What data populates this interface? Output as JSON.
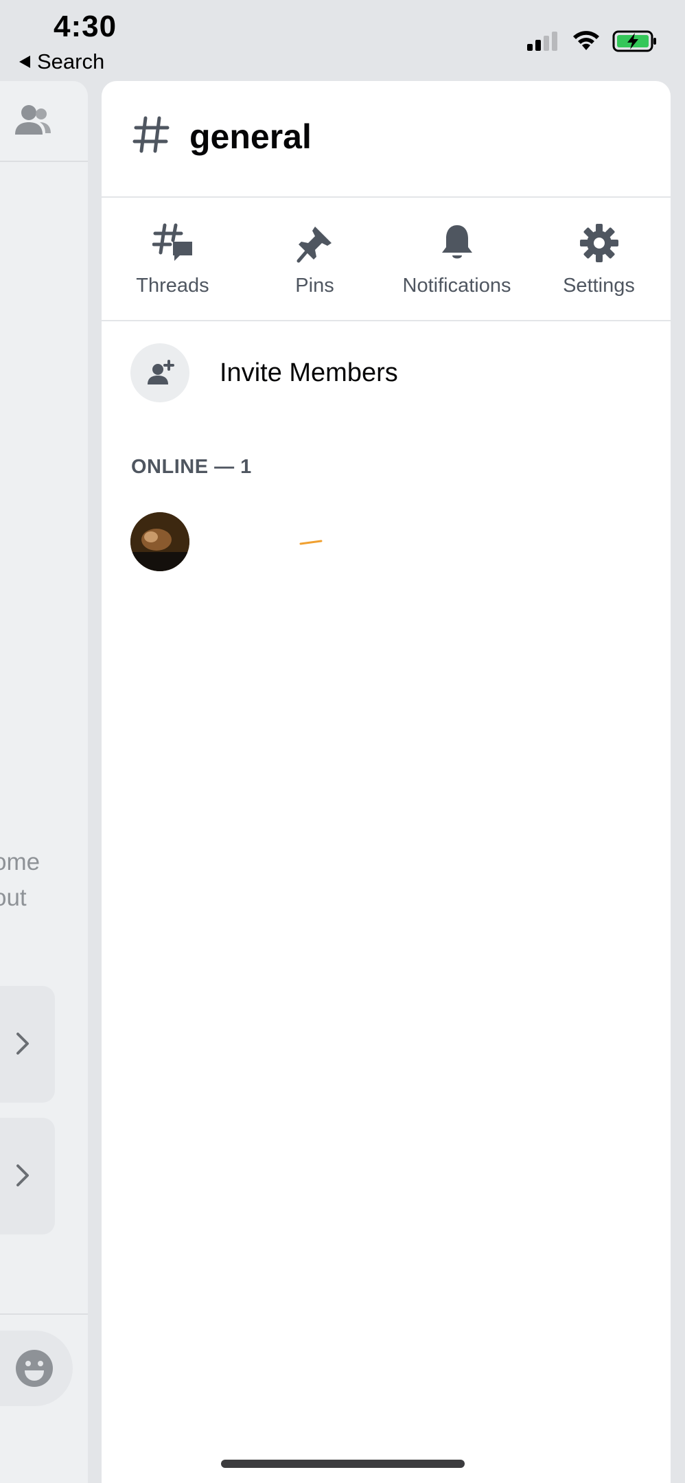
{
  "status_bar": {
    "time": "4:30",
    "back_label": "Search",
    "icons": [
      "cellular-signal-icon",
      "wifi-icon",
      "battery-charging-icon"
    ],
    "battery_color": "#34c759"
  },
  "background_panel": {
    "text_line_1": "ome",
    "text_line_2": "out"
  },
  "channel": {
    "name": "general",
    "icon": "hashtag-icon"
  },
  "actions": [
    {
      "label": "Threads",
      "icon": "threads-icon"
    },
    {
      "label": "Pins",
      "icon": "pin-icon"
    },
    {
      "label": "Notifications",
      "icon": "bell-icon"
    },
    {
      "label": "Settings",
      "icon": "gear-icon"
    }
  ],
  "invite": {
    "label": "Invite Members",
    "icon": "add-person-icon"
  },
  "members": {
    "section_header": "ONLINE — 1"
  },
  "colors": {
    "sheet_bg": "#ffffff",
    "app_bg": "#e3e5e8",
    "secondary_text": "#4f5660",
    "icon_gray": "#4f5660"
  }
}
